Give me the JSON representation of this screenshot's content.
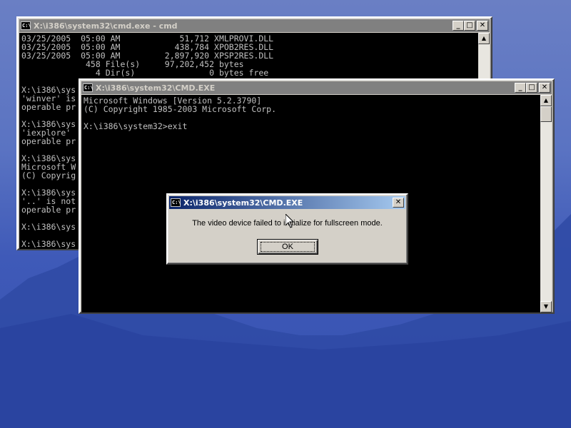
{
  "back_window": {
    "title": "X:\\i386\\system32\\cmd.exe - cmd",
    "lines": [
      "03/25/2005  05:00 AM            51,712 XMLPROVI.DLL",
      "03/25/2005  05:00 AM           438,784 XPOB2RES.DLL",
      "03/25/2005  05:00 AM         2,897,920 XPSP2RES.DLL",
      "             458 File(s)     97,202,452 bytes",
      "               4 Dir(s)               0 bytes free",
      "",
      "X:\\i386\\sys",
      "'winver' is",
      "operable pr",
      "",
      "X:\\i386\\sys",
      "'iexplore'",
      "operable pr",
      "",
      "X:\\i386\\sys",
      "Microsoft W",
      "(C) Copyrig",
      "",
      "X:\\i386\\sys",
      "'..' is not",
      "operable pr",
      "",
      "X:\\i386\\sys",
      "",
      "X:\\i386\\sys"
    ]
  },
  "front_window": {
    "title": "X:\\i386\\system32\\CMD.EXE",
    "lines": [
      "Microsoft Windows [Version 5.2.3790]",
      "(C) Copyright 1985-2003 Microsoft Corp.",
      "",
      "X:\\i386\\system32>exit"
    ]
  },
  "dialog": {
    "title": "X:\\i386\\system32\\CMD.EXE",
    "message": "The video device failed to initialize for fullscreen mode.",
    "ok_label": "OK",
    "close_glyph": "✕"
  },
  "titlebar_buttons": {
    "minimize": "_",
    "maximize": "□",
    "close": "✕"
  },
  "scroll_arrows": {
    "up": "▲",
    "down": "▼"
  },
  "icons": {
    "console_icon": "C:\\"
  }
}
